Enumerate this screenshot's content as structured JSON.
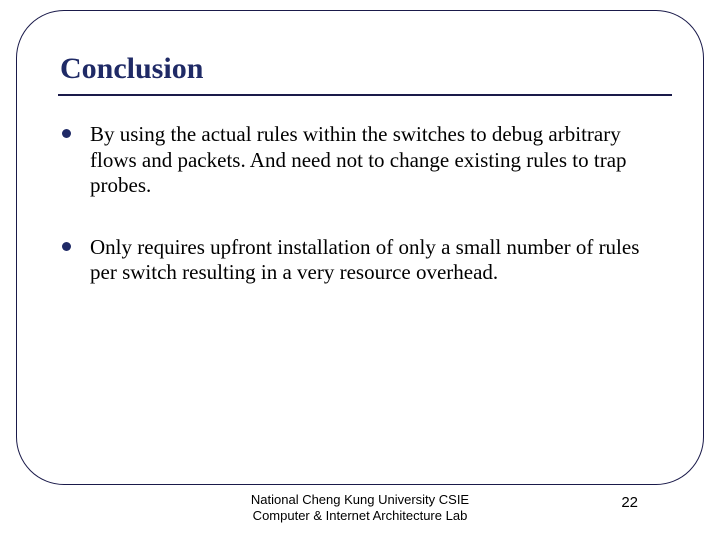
{
  "slide": {
    "title": "Conclusion",
    "bullets": [
      "By using the actual rules within the switches to debug arbitrary flows and packets. And need not to change existing rules to trap probes.",
      "Only requires upfront installation of only a small number of rules per switch resulting in a  very resource overhead."
    ]
  },
  "footer": {
    "line1": "National Cheng Kung University CSIE",
    "line2": "Computer & Internet Architecture Lab",
    "page_number": "22"
  }
}
